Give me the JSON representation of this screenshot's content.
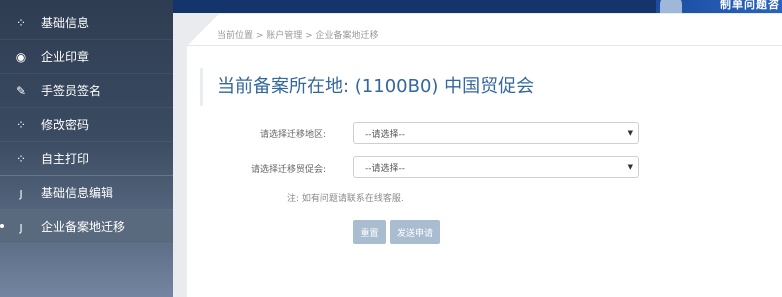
{
  "sidebar": {
    "items": [
      {
        "label": "基础信息",
        "icon": "spinner-icon",
        "glyph": "⁘"
      },
      {
        "label": "企业印章",
        "icon": "user-circle-icon",
        "glyph": "◉"
      },
      {
        "label": "手签员签名",
        "icon": "pencil-icon",
        "glyph": "✎"
      },
      {
        "label": "修改密码",
        "icon": "spinner-icon",
        "glyph": "⁘"
      },
      {
        "label": "自主打印",
        "icon": "spinner-icon",
        "glyph": "⁘"
      },
      {
        "label": "基础信息编辑",
        "icon": "fork-icon",
        "glyph": "ȷ"
      },
      {
        "label": "企业备案地迁移",
        "icon": "fork-icon",
        "glyph": "ȷ"
      }
    ]
  },
  "banner": {
    "text": "制单问题咨"
  },
  "breadcrumb": "当前位置 > 账户管理 > 企业备案地迁移",
  "page_title": "当前备案所在地: (1100B0) 中国贸促会",
  "form": {
    "region_label": "请选择迁移地区:",
    "region_value": "--请选择--",
    "council_label": "请选择迁移贸促会:",
    "council_value": "--请选择--",
    "note": "注:  如有问题请联系在线客服.",
    "reset_label": "重置",
    "submit_label": "发送申请"
  }
}
